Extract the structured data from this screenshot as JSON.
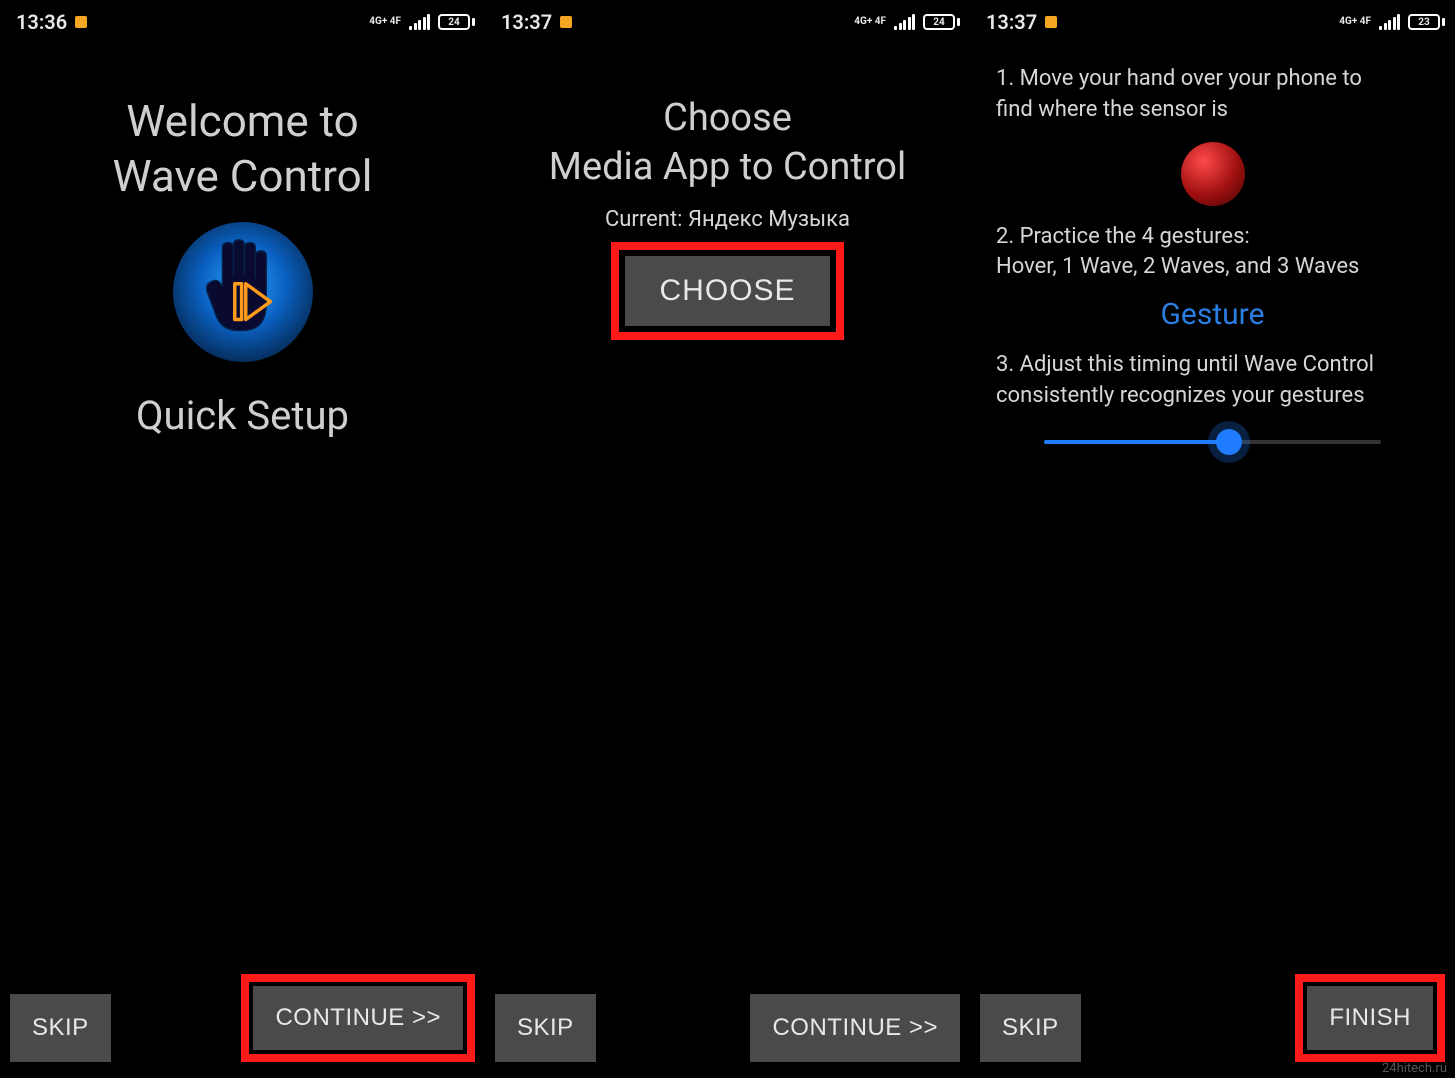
{
  "watermark": "24hitech.ru",
  "screens": [
    {
      "statusbar": {
        "time": "13:36",
        "net": "4G+\n4F",
        "battery": "24"
      },
      "title_line1": "Welcome to",
      "title_line2": "Wave Control",
      "subtitle": "Quick Setup",
      "skip_label": "SKIP",
      "continue_label": "CONTINUE >>"
    },
    {
      "statusbar": {
        "time": "13:37",
        "net": "4G+\n4F",
        "battery": "24"
      },
      "choose_line1": "Choose",
      "choose_line2": "Media App to Control",
      "current_prefix": "Current: ",
      "current_app": "Яндекс Музыка",
      "choose_button": "CHOOSE",
      "skip_label": "SKIP",
      "continue_label": "CONTINUE >>"
    },
    {
      "statusbar": {
        "time": "13:37",
        "net": "4G+\n4F",
        "battery": "23"
      },
      "step1": "1. Move your hand over your phone to find where the sensor is",
      "step2_line1": "2. Practice the 4 gestures:",
      "step2_line2": " Hover, 1 Wave, 2 Waves, and 3 Waves",
      "gesture_label": "Gesture",
      "step3": "3. Adjust this timing until Wave Control consistently recognizes your gestures",
      "slider_value_percent": 55,
      "skip_label": "SKIP",
      "finish_label": "FINISH"
    }
  ]
}
